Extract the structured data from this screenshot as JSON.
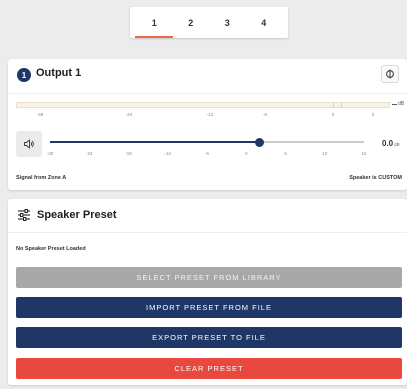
{
  "tabs": [
    {
      "label": "1",
      "active": true
    },
    {
      "label": "2",
      "active": false
    },
    {
      "label": "3",
      "active": false
    },
    {
      "label": "4",
      "active": false
    }
  ],
  "output": {
    "number": "1",
    "title": "Output 1",
    "phase_icon": "phase-invert-icon",
    "meter_scale": [
      "-48",
      "-24",
      "-12",
      "-6",
      "0",
      "3"
    ],
    "meter_unit": "dB",
    "volume_icon": "speaker-volume-icon",
    "slider_scale": [
      "-30",
      "-24",
      "-18",
      "-12",
      "-6",
      "0",
      "6",
      "12",
      "15"
    ],
    "volume_value": "0.0",
    "volume_unit": "dB",
    "volume_db": 0,
    "volume_range": [
      -30,
      15
    ],
    "source_text": "Signal from Zone A",
    "speaker_text": "Speaker is CUSTOM"
  },
  "preset": {
    "icon": "sliders-icon",
    "title": "Speaker Preset",
    "status": "No Speaker Preset Loaded",
    "select_label": "SELECT PRESET FROM LIBRARY",
    "import_label": "IMPORT PRESET FROM FILE",
    "export_label": "EXPORT PRESET TO FILE",
    "clear_label": "CLEAR PRESET"
  },
  "colors": {
    "accent": "#e86a46",
    "primary": "#1f3766",
    "disabled": "#a8a8a8",
    "danger": "#e8483e"
  }
}
